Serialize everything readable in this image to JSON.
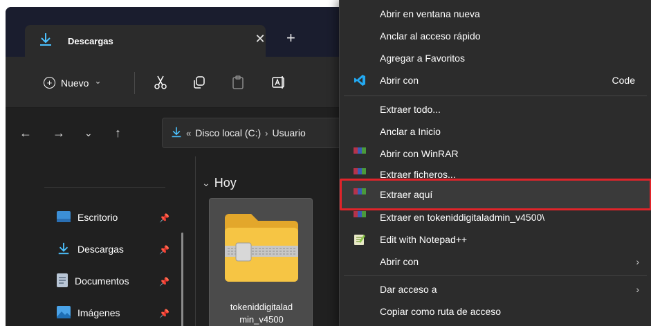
{
  "explorer": {
    "tab": {
      "title": "Descargas",
      "close_glyph": "✕",
      "new_tab_glyph": "+"
    },
    "toolbar": {
      "new_label": "Nuevo",
      "new_chevron": "⌄"
    },
    "navbar": {
      "back_glyph": "←",
      "forward_glyph": "→",
      "recent_glyph": "⌄",
      "up_glyph": "↑",
      "address": {
        "overflow": "«",
        "part1": "Disco local (C:)",
        "sep": "›",
        "part2": "Usuario"
      }
    },
    "sidebar": {
      "items": [
        {
          "label": "Escritorio",
          "icon": "desktop-icon"
        },
        {
          "label": "Descargas",
          "icon": "download-icon"
        },
        {
          "label": "Documentos",
          "icon": "document-icon"
        },
        {
          "label": "Imágenes",
          "icon": "pictures-icon"
        }
      ]
    },
    "content": {
      "group_label": "Hoy",
      "file": {
        "name_line1": "tokeniddigitalad",
        "name_line2": "min_v4500",
        "icon": "zip-folder-icon"
      }
    }
  },
  "context_menu": {
    "items": [
      {
        "label": "Abrir en ventana nueva"
      },
      {
        "label": "Anclar al acceso rápido"
      },
      {
        "label": "Agregar a Favoritos"
      },
      {
        "label": "Abrir con",
        "right_text": "Code",
        "icon": "vscode-icon"
      },
      {
        "label": "Extraer todo..."
      },
      {
        "label": "Anclar a Inicio"
      },
      {
        "label": "Abrir con WinRAR",
        "icon": "winrar-icon"
      },
      {
        "label": "Extraer ficheros...",
        "icon": "winrar-icon"
      },
      {
        "label": "Extraer aquí",
        "icon": "winrar-icon",
        "highlighted": true
      },
      {
        "label": "Extraer en tokeniddigitaladmin_v4500\\",
        "icon": "winrar-icon"
      },
      {
        "label": "Edit with Notepad++",
        "icon": "notepad-plus-plus-icon"
      },
      {
        "label": "Abrir con",
        "submenu": true
      },
      {
        "label": "Dar acceso a",
        "submenu": true
      },
      {
        "label": "Copiar como ruta de acceso"
      }
    ],
    "submenu_glyph": "›"
  },
  "colors": {
    "highlight_outline": "#e0242a",
    "menu_bg": "#2c2c2c",
    "window_bg": "#202020"
  }
}
